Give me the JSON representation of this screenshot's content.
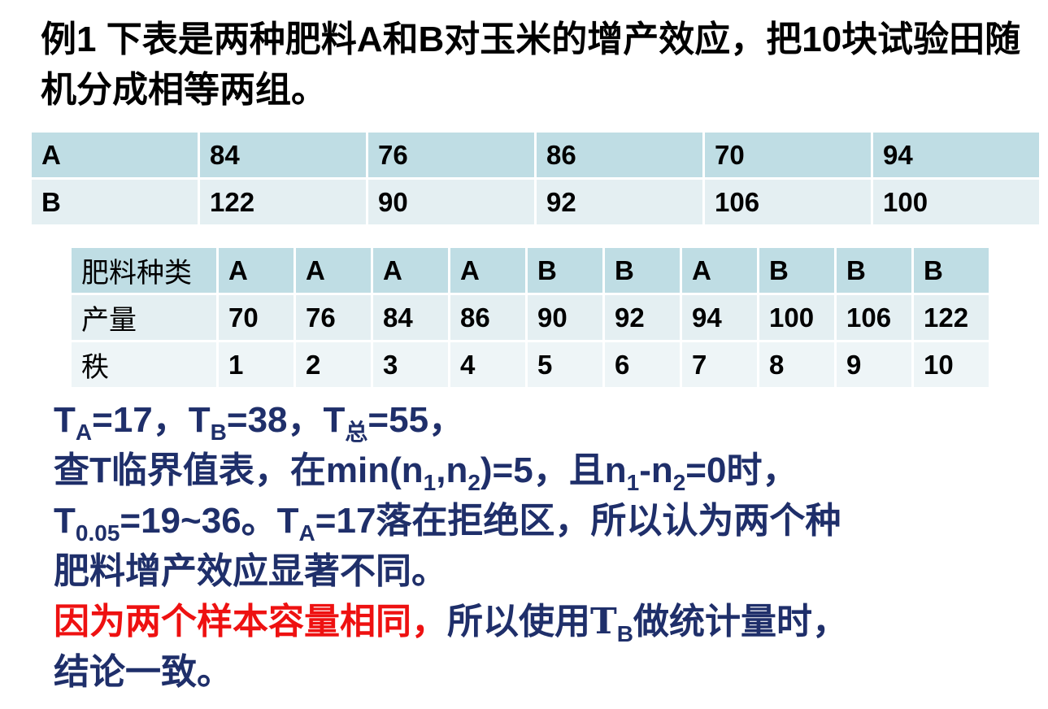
{
  "title": "例1 下表是两种肥料A和B对玉米的增产效应，把10块试验田随机分成相等两组。",
  "table1": {
    "rows": [
      [
        "A",
        "84",
        "76",
        "86",
        "70",
        "94"
      ],
      [
        "B",
        "122",
        "90",
        "92",
        "106",
        "100"
      ]
    ]
  },
  "table2": {
    "rows": [
      [
        "肥料种类",
        "A",
        "A",
        "A",
        "A",
        "B",
        "B",
        "A",
        "B",
        "B",
        "B"
      ],
      [
        "产量",
        "70",
        "76",
        "84",
        "86",
        "90",
        "92",
        "94",
        "100",
        "106",
        "122"
      ],
      [
        "秩",
        "1",
        "2",
        "3",
        "4",
        "5",
        "6",
        "7",
        "8",
        "9",
        "10"
      ]
    ]
  },
  "statement": {
    "l1": {
      "a": "T",
      "a_sub": "A",
      "b": "=17，T",
      "b_sub": "B",
      "c": "=38，T",
      "c_sub": "总",
      "d": "=55，"
    },
    "l2": {
      "a": "查T临界值表，在min(n",
      "s1": "1",
      "b": ",n",
      "s2": "2",
      "c": ")=5，且n",
      "s3": "1",
      "d": "-n",
      "s4": "2",
      "e": "=0时，"
    },
    "l3": {
      "a": "T",
      "s1": "0.05",
      "b": "=19~36。T",
      "s2": "A",
      "c": "=17落在拒绝区，所以认为两个种"
    },
    "l4": "肥料增产效应显著不同。",
    "l5": {
      "red": "因为两个样本容量相同，",
      "a": "所以使用T",
      "s1": "B",
      "b": "做统计量时，"
    },
    "l6": "结论一致。"
  },
  "colors": {
    "table_header": "#bfdde4",
    "table_row": "#e4eff2",
    "statement_text": "#1f2f6a",
    "highlight": "#ee1111"
  }
}
